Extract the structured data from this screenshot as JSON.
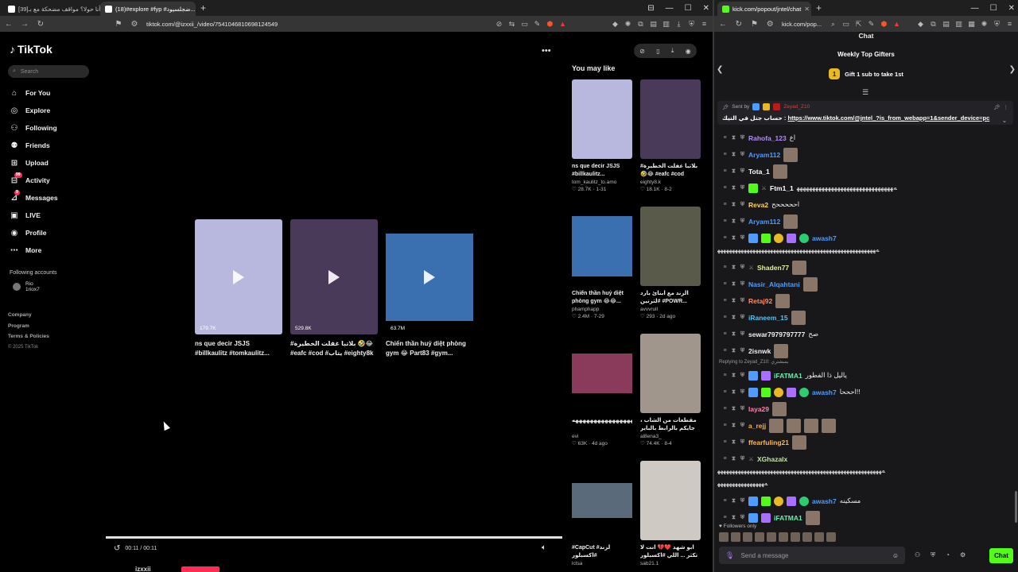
{
  "left_window": {
    "tabs": [
      {
        "title": "[39]البش أنا حولا؟ مواقف مضحكة مع بـ...",
        "active": false,
        "favicon_color": "#ffffff"
      },
      {
        "title": "(18)#explore #fyp #ضجلسيود...",
        "active": true,
        "favicon_color": "#ffffff"
      }
    ],
    "new_tab": "+",
    "url": "tiktok.com/@izxxii_/video/7541046810698124549",
    "controls": [
      "⊟",
      "—",
      "☐",
      "✕"
    ]
  },
  "tiktok": {
    "logo": "TikTok",
    "search_placeholder": "Search",
    "nav": [
      {
        "label": "For You",
        "icon": "home-icon",
        "glyph": "⌂"
      },
      {
        "label": "Explore",
        "icon": "compass-icon",
        "glyph": "◎"
      },
      {
        "label": "Following",
        "icon": "following-icon",
        "glyph": "⚇"
      },
      {
        "label": "Friends",
        "icon": "friends-icon",
        "glyph": "⚉"
      },
      {
        "label": "Upload",
        "icon": "upload-icon",
        "glyph": "⊞"
      },
      {
        "label": "Activity",
        "icon": "activity-icon",
        "glyph": "⊟",
        "badge": "99"
      },
      {
        "label": "Messages",
        "icon": "messages-icon",
        "glyph": "⊿",
        "badge": "9"
      },
      {
        "label": "LIVE",
        "icon": "live-icon",
        "glyph": "▣"
      },
      {
        "label": "Profile",
        "icon": "profile-icon",
        "glyph": "◉"
      },
      {
        "label": "More",
        "icon": "more-icon",
        "glyph": "⋯"
      }
    ],
    "following_accounts_title": "Following accounts",
    "following_account": {
      "name": "Rio",
      "handle": "1riox7"
    },
    "footer": [
      "Company",
      "Program",
      "Terms & Policies"
    ],
    "copyright": "© 2025 TikTok",
    "related": [
      {
        "views": "179.7K",
        "title": "ns que decir JSJS #billkaulitz #tomkaulitz...",
        "color": "#b8b8de"
      },
      {
        "views": "529.8K",
        "title": "#بلاتبا غفلت الخطيرة 🤣😂 #eafc #cod #يتاب #eighty8k",
        "color": "#4a3a5a"
      },
      {
        "views": "63.7M",
        "title": "Chiến thần huỷ diệt phòng gym 😂 Part83 #gym...",
        "color": "#3a6fb0"
      }
    ],
    "time": "00:11 / 00:11",
    "author": "izxxii",
    "progress": 1.0,
    "you_may_like_title": "You may like",
    "you_may_like": [
      {
        "title": "ns que decir JSJS #billkaulitz...",
        "author": "tom_kaulitz_to.amo",
        "likes": "♡ 28.7K",
        "age": "1-31",
        "color": "#b8b8de"
      },
      {
        "title": "#بلاتبا غفلت الخطيرة 🤣😂 #eafc #cod #يتاب...",
        "author": "eighty8.k",
        "likes": "♡ 18.1K",
        "age": "8-2",
        "color": "#4a3a5a"
      },
      {
        "title": "Chiến thần huỷ diệt phòng gym 😂😂...",
        "author": "phamphapp",
        "likes": "♡ 2.4M",
        "age": "7-29",
        "color": "#3a6fb0"
      },
      {
        "title": "الزند مع ابنائ بارد #لثرتين #POWR...",
        "author": "avvvrull",
        "likes": "♡ 293",
        "age": "2d ago",
        "color": "#5a5a4a"
      },
      {
        "title": "ههههههههههههههههههههههههه...",
        "author": "evi",
        "likes": "♡ 63K",
        "age": "4d ago",
        "color": "#8a3a5a"
      },
      {
        "title": "مقطعات من الشاب ، جايكم بالرابط بالباير 🤣😂",
        "author": "al8ena3_",
        "likes": "♡ 74.4K",
        "age": "8-4",
        "color": "#a0968c"
      },
      {
        "title": "#CapCut #لزند #اكسبلور #التحدي_السوداني_مغه_سل",
        "author": "lctsa",
        "likes": "",
        "age": "",
        "color": "#5a6a7a"
      },
      {
        "title": "ابو شهد ❤️💔 انت لا تكثر ... اللي #اكسبلور #الكبار...",
        "author": "sab21.1",
        "likes": "",
        "age": "",
        "color": "#cfc9c4"
      }
    ]
  },
  "right_window": {
    "tab_title": "kick.com/popout/jntel/chat",
    "url": "kick.com/pop...",
    "controls": [
      "—",
      "☐",
      "✕"
    ]
  },
  "chat": {
    "header": "Chat",
    "gifters_title": "Weekly Top Gifters",
    "gift_cta": "Gift 1 sub to take 1st",
    "gift_rank": "1",
    "pinned_prefix": "Sent by",
    "pinned_sender": "Zeyad_Z10",
    "pinned_text": "حساب جتل في التيك :",
    "pinned_link": "https://www.tiktok.com/@jntel_?is_from_webapp=1&sender_device=pc",
    "messages": [
      {
        "user": "Rahofa_123",
        "color": "#b388ff",
        "text": "اع",
        "emote": false
      },
      {
        "user": "Aryam112",
        "color": "#4f9cff",
        "text": "",
        "emote": true
      },
      {
        "user": "Tota_1",
        "color": "#ffffff",
        "text": "",
        "emote": true
      },
      {
        "user": "Ftm1_1",
        "color": "#ffffff",
        "text": "ﻪﻬﻬﻬﻬﻬﻬﻬﻬﻬﻬﻬﻬﻬﻬﻬﻬﻬﻬﻬﻬﻬﻬﻬﻬﻬﻬﻬﻬﻬﻬﻬ",
        "emote": false,
        "badges": true
      },
      {
        "user": "Reva2",
        "color": "#ffd54f",
        "text": "احححححح",
        "emote": false
      },
      {
        "user": "Aryam112",
        "color": "#4f9cff",
        "text": "",
        "emote": true
      },
      {
        "user": "awash7",
        "color": "#4f9cff",
        "text": "",
        "emote": false,
        "badges": true
      },
      {
        "user": "Shaden77",
        "color": "#e6ee9c",
        "text": "",
        "emote": true
      },
      {
        "user": "Nasir_Alqahtani",
        "color": "#4f9cff",
        "text": "",
        "emote": true
      },
      {
        "user": "Retaj92",
        "color": "#ff8a65",
        "text": "",
        "emote": true
      },
      {
        "user": "iRaneem_15",
        "color": "#4fc3f7",
        "text": "",
        "emote": true
      },
      {
        "user": "sewar7979797777",
        "color": "#eeeeee",
        "text": "صح",
        "emote": false
      },
      {
        "user": "2isnwk",
        "color": "#eeeeee",
        "text": "",
        "emote": true
      },
      {
        "user": "iFATMA1",
        "color": "#69f0ae",
        "text": "ياليل ذا الفطور",
        "emote": false,
        "badges": true
      },
      {
        "user": "awash7",
        "color": "#4f9cff",
        "text": "احححا!!",
        "emote": false,
        "badges": true
      },
      {
        "user": "laya29",
        "color": "#ff80ab",
        "text": "",
        "emote": true
      },
      {
        "user": "a_rejj",
        "color": "#ffab40",
        "text": "",
        "emote": true
      },
      {
        "user": "ffearfuling21",
        "color": "#ffb74d",
        "text": "",
        "emote": true
      },
      {
        "user": "XGhazalx",
        "color": "#c5e1a5",
        "text": "",
        "emote": false
      },
      {
        "user": "awash7",
        "color": "#4f9cff",
        "text": "مسكينه",
        "emote": false,
        "badges": true
      },
      {
        "user": "iFATMA1",
        "color": "#69f0ae",
        "text": "",
        "emote": true,
        "badges": true
      }
    ],
    "wrap_line_1": "ﻪﻬﻬﻬﻬﻬﻬﻬﻬﻬﻬﻬﻬﻬﻬﻬﻬﻬﻬﻬﻬﻬﻬﻬﻬﻬﻬﻬﻬﻬﻬﻬﻬﻬﻬﻬﻬﻬﻬﻬﻬﻬﻬﻬﻬﻬﻬﻬﻬﻬﻬﻬﻬﻬﻬ",
    "reply_to": "Replying to Zeyad_Z10: بسشتري",
    "wrap_line_2": "ﻪﻬﻬﻬﻬﻬﻬﻬﻬﻬﻬﻬﻬﻬﻬﻬﻬﻬﻬﻬﻬﻬﻬﻬﻬﻬﻬﻬﻬﻬﻬﻬﻬﻬﻬﻬﻬﻬﻬﻬﻬﻬﻬﻬﻬﻬﻬﻬﻬﻬﻬﻬﻬﻬﻬﻬﻬ",
    "wrap_line_3": "ﻪﻬﻬﻬﻬﻬﻬﻬﻬﻬﻬﻬﻬﻬﻬﻬﻬ",
    "followers_only": "♥ Followers only",
    "input_placeholder": "Send a message",
    "chat_button": "Chat"
  }
}
